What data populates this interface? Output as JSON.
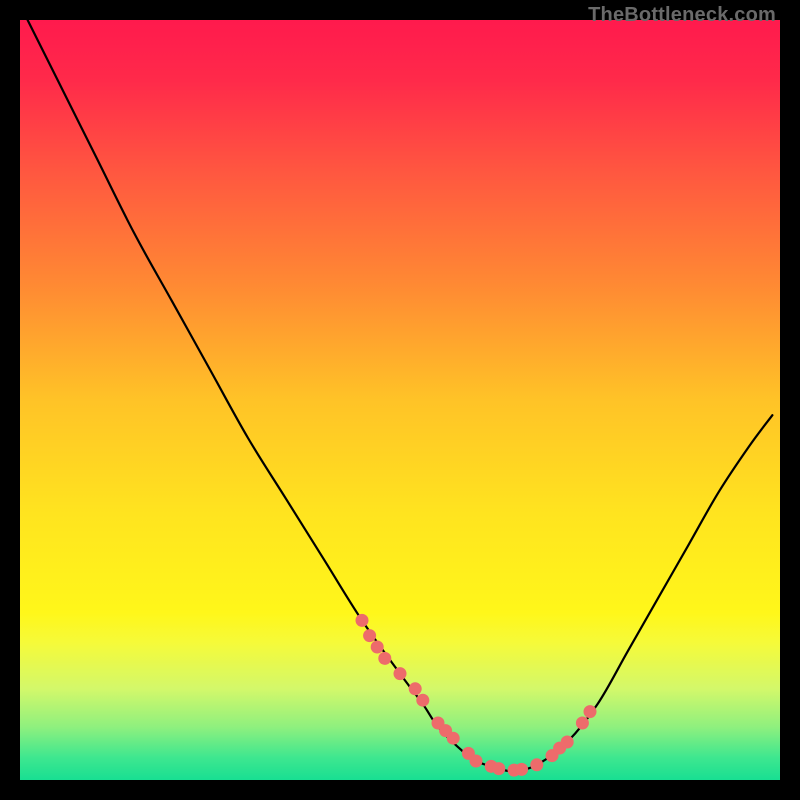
{
  "watermark": "TheBottleneck.com",
  "chart_data": {
    "type": "line",
    "title": "",
    "xlabel": "",
    "ylabel": "",
    "xlim": [
      0,
      100
    ],
    "ylim": [
      0,
      100
    ],
    "grid": false,
    "legend": false,
    "background_gradient": {
      "stops": [
        {
          "offset": 0.0,
          "color": "#ff1a4d"
        },
        {
          "offset": 0.08,
          "color": "#ff2a4a"
        },
        {
          "offset": 0.2,
          "color": "#ff5740"
        },
        {
          "offset": 0.35,
          "color": "#ff8a33"
        },
        {
          "offset": 0.5,
          "color": "#ffc327"
        },
        {
          "offset": 0.65,
          "color": "#ffe41f"
        },
        {
          "offset": 0.78,
          "color": "#fff71a"
        },
        {
          "offset": 0.82,
          "color": "#f5fa3a"
        },
        {
          "offset": 0.88,
          "color": "#d3f86a"
        },
        {
          "offset": 0.93,
          "color": "#8ff07e"
        },
        {
          "offset": 0.97,
          "color": "#3fe78f"
        },
        {
          "offset": 1.0,
          "color": "#18df92"
        }
      ]
    },
    "series": [
      {
        "name": "bottleneck-curve",
        "color": "#000000",
        "x": [
          1,
          5,
          10,
          15,
          20,
          25,
          30,
          35,
          40,
          45,
          50,
          53,
          55,
          58,
          60,
          63,
          65,
          68,
          72,
          76,
          80,
          84,
          88,
          92,
          96,
          99
        ],
        "y": [
          100,
          92,
          82,
          72,
          63,
          54,
          45,
          37,
          29,
          21,
          14,
          10,
          7,
          4,
          2.5,
          1.5,
          1.2,
          2,
          5,
          10,
          17,
          24,
          31,
          38,
          44,
          48
        ]
      },
      {
        "name": "highlight-dots",
        "color": "#ed6b6b",
        "type": "scatter",
        "x": [
          45,
          46,
          47,
          48,
          50,
          52,
          53,
          55,
          56,
          57,
          59,
          60,
          62,
          63,
          65,
          66,
          68,
          70,
          71,
          72,
          74,
          75
        ],
        "y": [
          21,
          19,
          17.5,
          16,
          14,
          12,
          10.5,
          7.5,
          6.5,
          5.5,
          3.5,
          2.5,
          1.8,
          1.5,
          1.3,
          1.4,
          2,
          3.2,
          4.2,
          5,
          7.5,
          9
        ]
      }
    ]
  }
}
